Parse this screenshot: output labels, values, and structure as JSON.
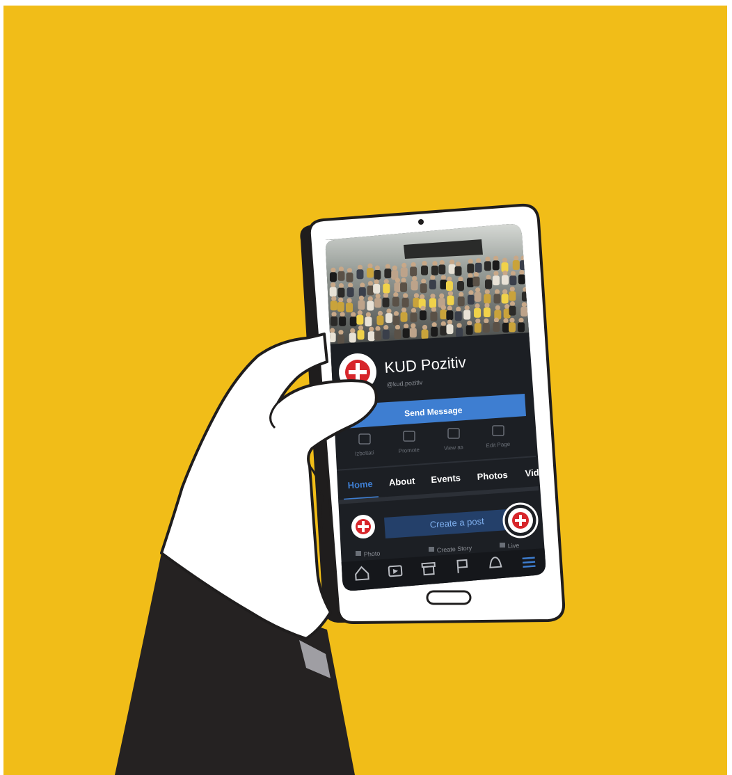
{
  "colors": {
    "background": "#f1bd18",
    "phone_body": "#ffffff",
    "phone_edge": "#1f1d1d",
    "screen": "#1c1f24",
    "accent": "#3e7ed1",
    "sleeve": "#252222",
    "hand": "#ffffff"
  },
  "page": {
    "name": "KUD Pozitiv",
    "handle": "@kud.pozitiv",
    "send_message_label": "Send Message",
    "actions": [
      {
        "label": "Izboltati",
        "icon": "edit-icon"
      },
      {
        "label": "Promote",
        "icon": "megaphone-icon"
      },
      {
        "label": "View as",
        "icon": "eye-icon"
      },
      {
        "label": "Edit Page",
        "icon": "pencil-icon"
      }
    ],
    "tabs": [
      {
        "label": "Home",
        "active": true
      },
      {
        "label": "About",
        "active": false
      },
      {
        "label": "Events",
        "active": false
      },
      {
        "label": "Photos",
        "active": false
      },
      {
        "label": "Vid",
        "active": false
      }
    ],
    "create_post_label": "Create a post",
    "post_options": [
      {
        "label": "Photo",
        "icon": "photo-icon"
      },
      {
        "label": "Create Story",
        "icon": "story-icon"
      },
      {
        "label": "Live",
        "icon": "live-icon"
      }
    ]
  },
  "bottom_nav": [
    {
      "name": "home-icon",
      "active": false
    },
    {
      "name": "watch-icon",
      "active": false
    },
    {
      "name": "marketplace-icon",
      "active": false
    },
    {
      "name": "pages-flag-icon",
      "active": false
    },
    {
      "name": "notifications-bell-icon",
      "active": false
    },
    {
      "name": "menu-icon",
      "active": true
    }
  ]
}
